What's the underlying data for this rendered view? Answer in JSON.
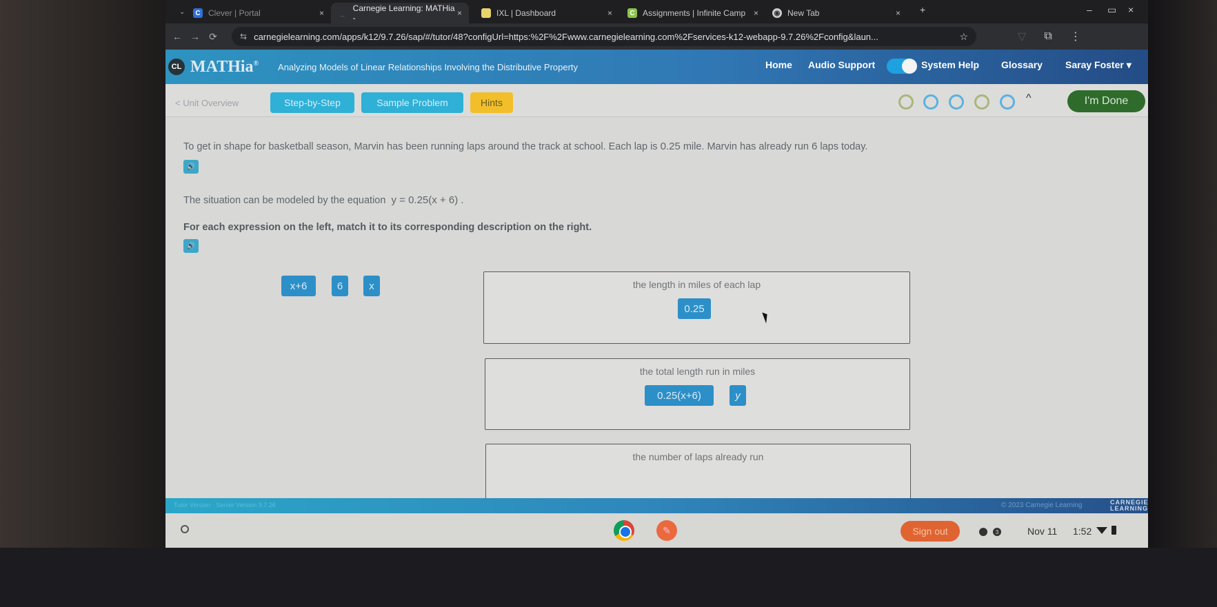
{
  "browser": {
    "tabs": [
      {
        "title": "Clever | Portal",
        "favicon": "C",
        "favicon_color": "#2f6fd6",
        "active": false
      },
      {
        "title": "Carnegie Learning: MATHia -",
        "favicon": "",
        "favicon_color": "#888888",
        "active": true
      },
      {
        "title": "IXL | Dashboard",
        "favicon": "",
        "favicon_color": "#e8d36a",
        "active": false
      },
      {
        "title": "Assignments | Infinite Camp",
        "favicon": "C",
        "favicon_color": "#8bc34a",
        "active": false
      },
      {
        "title": "New Tab",
        "favicon": "chrome-icon",
        "favicon_color": "#cccccc",
        "active": false
      }
    ],
    "close_glyph": "×",
    "new_tab_glyph": "+",
    "url": "carnegielearning.com/apps/k12/9.7.26/sap/#/tutor/48?configUrl=https:%2F%2Fwww.carnegielearning.com%2Fservices-k12-webapp-9.7.26%2Fconfig&laun...",
    "nav": {
      "back": "←",
      "forward": "→",
      "reload": "C",
      "site_info": "⇆",
      "star": "☆",
      "menu": "⋮"
    }
  },
  "app": {
    "logo_text": "CL",
    "brand": "MATHia",
    "brand_mark": "®",
    "lesson_title": "Analyzing Models of Linear Relationships Involving the Distributive Property",
    "nav": {
      "home": "Home",
      "audio_support": "Audio Support",
      "audio_support_on": true,
      "system_help": "System Help",
      "glossary": "Glossary",
      "user": "Saray Foster ▾"
    },
    "toolbar": {
      "unit_overview": "< Unit Overview",
      "step_by_step": "Step-by-Step",
      "sample_problem": "Sample Problem",
      "hints": "Hints",
      "progress_indicators": [
        "incomplete",
        "in-progress",
        "in-progress",
        "incomplete",
        "in-progress"
      ],
      "collapse_glyph": "^",
      "done": "I'm Done"
    }
  },
  "problem": {
    "intro_a": "To get in shape for basketball season, Marvin has been running laps around the track at school. Each lap is",
    "lap_length": "0.25",
    "intro_b": "mile. Marvin has already run",
    "laps_run": "6",
    "intro_c": "laps today.",
    "model_text": "The situation can be modeled by the equation",
    "equation": "y = 0.25(x + 6) .",
    "instruction": "For each expression on the left, match it to its corresponding description on the right.",
    "audio_glyph": "🔊"
  },
  "matching": {
    "source_chips": [
      "x+6",
      "6",
      "x"
    ],
    "targets": [
      {
        "description": "the length in miles of each lap",
        "placed": [
          "0.25"
        ]
      },
      {
        "description": "the total length run in miles",
        "placed": [
          "0.25(x+6)",
          "y"
        ]
      },
      {
        "description": "the number of laps already run",
        "placed": []
      }
    ]
  },
  "footer": {
    "left_text": "Tutor Version · Server Version 9.7.26",
    "copyright": "© 2023 Carnegie Learning",
    "logo_line1": "CARNEGIE",
    "logo_line2": "LEARNING"
  },
  "shelf": {
    "sign_out": "Sign out",
    "notification_count": "3",
    "date": "Nov 11",
    "time": "1:52"
  }
}
